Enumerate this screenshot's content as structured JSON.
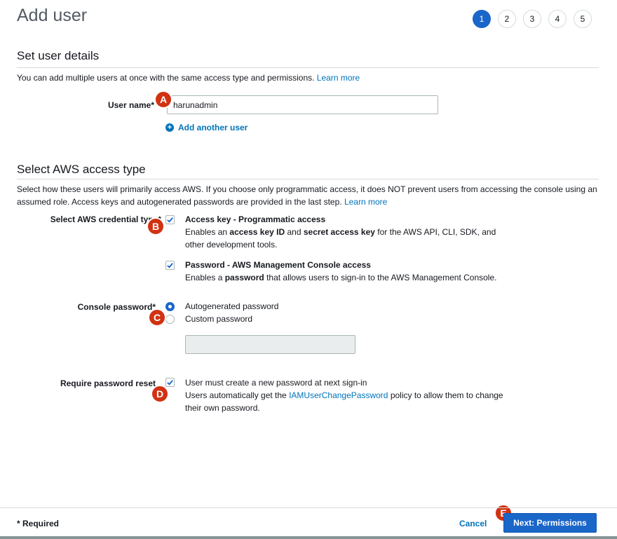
{
  "page": {
    "title": "Add user"
  },
  "steps": [
    "1",
    "2",
    "3",
    "4",
    "5"
  ],
  "set_user_details": {
    "heading": "Set user details",
    "description": "You can add multiple users at once with the same access type and permissions.",
    "learn_more": "Learn more",
    "user_name_label": "User name*",
    "user_name_value": "harunadmin",
    "add_another_user": "Add another user"
  },
  "access_type": {
    "heading": "Select AWS access type",
    "description": "Select how these users will primarily access AWS. If you choose only programmatic access, it does NOT prevent users from accessing the console using an assumed role. Access keys and autogenerated passwords are provided in the last step.",
    "learn_more": "Learn more",
    "credential_label": "Select AWS credential type*",
    "programmatic": {
      "checked": true,
      "title": "Access key - Programmatic access",
      "desc_1": "Enables an",
      "desc_b1": "access key ID",
      "desc_2": "and",
      "desc_b2": "secret access key",
      "desc_3": "for the AWS API, CLI, SDK, and other development tools."
    },
    "console": {
      "checked": true,
      "title": "Password - AWS Management Console access",
      "desc_1": "Enables a",
      "desc_b1": "password",
      "desc_2": "that allows users to sign-in to the AWS Management Console."
    }
  },
  "console_password": {
    "label": "Console password*",
    "options": [
      "Autogenerated password",
      "Custom password"
    ],
    "selected": "Autogenerated password",
    "custom_value": ""
  },
  "password_reset": {
    "label": "Require password reset",
    "checked": true,
    "text": "User must create a new password at next sign-in",
    "desc_1": "Users automatically get the",
    "policy_link": "IAMUserChangePassword",
    "desc_2": "policy to allow them to change their own password."
  },
  "annotations": [
    "A",
    "B",
    "C",
    "D",
    "E"
  ],
  "footer": {
    "required_note": "* Required",
    "cancel": "Cancel",
    "next": "Next: Permissions"
  },
  "colors": {
    "primary": "#1b66c9",
    "link": "#0073bb",
    "annotation": "#d13212"
  }
}
